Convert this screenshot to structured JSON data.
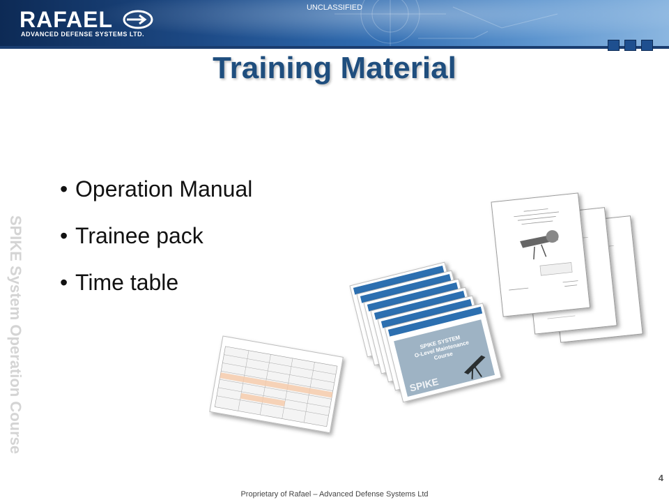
{
  "header": {
    "logo_text": "RAFAEL",
    "logo_subtext": "ADVANCED DEFENSE SYSTEMS LTD.",
    "classification": "UNCLASSIFIED"
  },
  "slide": {
    "title": "Training Material",
    "side_label": "SPIKE System Operation Course",
    "bullets": [
      "Operation Manual",
      "Trainee pack",
      "Time table"
    ],
    "page_number": "4"
  },
  "footer": {
    "text": "Proprietary of Rafael – Advanced Defense Systems Ltd"
  },
  "thumbnails": {
    "course_cover_title": "SPIKE SYSTEM\nO-Level Maintenance\nCourse",
    "course_cover_brand": "SPIKE"
  },
  "colors": {
    "title": "#1f4e7e",
    "banner_dark": "#0d2a55",
    "banner_light": "#8bb6e0",
    "side_label": "#d4d4d4"
  }
}
